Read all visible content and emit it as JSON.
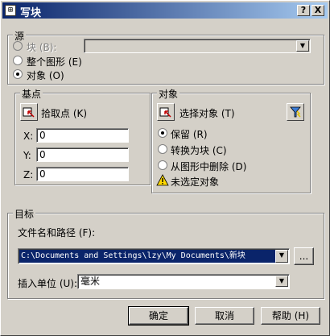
{
  "window": {
    "title": "写块",
    "help_btn": "?",
    "close_btn": "X"
  },
  "source": {
    "group_label": "源",
    "block_label": "块 (B):",
    "entire_drawing_label": "整个图形 (E)",
    "objects_label": "对象 (O)",
    "selected": "objects"
  },
  "base_point": {
    "group_label": "基点",
    "pick_label": "拾取点 (K)",
    "x_label": "X:",
    "x_value": "0",
    "y_label": "Y:",
    "y_value": "0",
    "z_label": "Z:",
    "z_value": "0"
  },
  "objects": {
    "group_label": "对象",
    "select_label": "选择对象 (T)",
    "retain_label": "保留 (R)",
    "convert_label": "转换为块 (C)",
    "delete_label": "从图形中删除 (D)",
    "selected": "retain",
    "warning_text": "未选定对象"
  },
  "destination": {
    "group_label": "目标",
    "path_label": "文件名和路径 (F):",
    "path_value": "C:\\Documents and Settings\\lzy\\My Documents\\新块",
    "browse_label": "...",
    "units_label": "插入单位 (U):",
    "units_value": "毫米"
  },
  "buttons": {
    "ok": "确定",
    "cancel": "取消",
    "help": "帮助 (H)"
  },
  "colors": {
    "titlebar_start": "#0a246a",
    "titlebar_end": "#a6caf0",
    "face": "#d4d0c8",
    "selection": "#0a246a"
  }
}
